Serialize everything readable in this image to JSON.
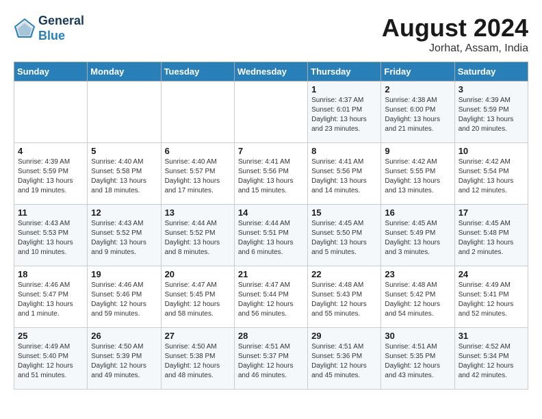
{
  "header": {
    "logo_line1": "General",
    "logo_line2": "Blue",
    "month_title": "August 2024",
    "location": "Jorhat, Assam, India"
  },
  "weekdays": [
    "Sunday",
    "Monday",
    "Tuesday",
    "Wednesday",
    "Thursday",
    "Friday",
    "Saturday"
  ],
  "weeks": [
    [
      {
        "day": "",
        "info": ""
      },
      {
        "day": "",
        "info": ""
      },
      {
        "day": "",
        "info": ""
      },
      {
        "day": "",
        "info": ""
      },
      {
        "day": "1",
        "info": "Sunrise: 4:37 AM\nSunset: 6:01 PM\nDaylight: 13 hours\nand 23 minutes."
      },
      {
        "day": "2",
        "info": "Sunrise: 4:38 AM\nSunset: 6:00 PM\nDaylight: 13 hours\nand 21 minutes."
      },
      {
        "day": "3",
        "info": "Sunrise: 4:39 AM\nSunset: 5:59 PM\nDaylight: 13 hours\nand 20 minutes."
      }
    ],
    [
      {
        "day": "4",
        "info": "Sunrise: 4:39 AM\nSunset: 5:59 PM\nDaylight: 13 hours\nand 19 minutes."
      },
      {
        "day": "5",
        "info": "Sunrise: 4:40 AM\nSunset: 5:58 PM\nDaylight: 13 hours\nand 18 minutes."
      },
      {
        "day": "6",
        "info": "Sunrise: 4:40 AM\nSunset: 5:57 PM\nDaylight: 13 hours\nand 17 minutes."
      },
      {
        "day": "7",
        "info": "Sunrise: 4:41 AM\nSunset: 5:56 PM\nDaylight: 13 hours\nand 15 minutes."
      },
      {
        "day": "8",
        "info": "Sunrise: 4:41 AM\nSunset: 5:56 PM\nDaylight: 13 hours\nand 14 minutes."
      },
      {
        "day": "9",
        "info": "Sunrise: 4:42 AM\nSunset: 5:55 PM\nDaylight: 13 hours\nand 13 minutes."
      },
      {
        "day": "10",
        "info": "Sunrise: 4:42 AM\nSunset: 5:54 PM\nDaylight: 13 hours\nand 12 minutes."
      }
    ],
    [
      {
        "day": "11",
        "info": "Sunrise: 4:43 AM\nSunset: 5:53 PM\nDaylight: 13 hours\nand 10 minutes."
      },
      {
        "day": "12",
        "info": "Sunrise: 4:43 AM\nSunset: 5:52 PM\nDaylight: 13 hours\nand 9 minutes."
      },
      {
        "day": "13",
        "info": "Sunrise: 4:44 AM\nSunset: 5:52 PM\nDaylight: 13 hours\nand 8 minutes."
      },
      {
        "day": "14",
        "info": "Sunrise: 4:44 AM\nSunset: 5:51 PM\nDaylight: 13 hours\nand 6 minutes."
      },
      {
        "day": "15",
        "info": "Sunrise: 4:45 AM\nSunset: 5:50 PM\nDaylight: 13 hours\nand 5 minutes."
      },
      {
        "day": "16",
        "info": "Sunrise: 4:45 AM\nSunset: 5:49 PM\nDaylight: 13 hours\nand 3 minutes."
      },
      {
        "day": "17",
        "info": "Sunrise: 4:45 AM\nSunset: 5:48 PM\nDaylight: 13 hours\nand 2 minutes."
      }
    ],
    [
      {
        "day": "18",
        "info": "Sunrise: 4:46 AM\nSunset: 5:47 PM\nDaylight: 13 hours\nand 1 minute."
      },
      {
        "day": "19",
        "info": "Sunrise: 4:46 AM\nSunset: 5:46 PM\nDaylight: 12 hours\nand 59 minutes."
      },
      {
        "day": "20",
        "info": "Sunrise: 4:47 AM\nSunset: 5:45 PM\nDaylight: 12 hours\nand 58 minutes."
      },
      {
        "day": "21",
        "info": "Sunrise: 4:47 AM\nSunset: 5:44 PM\nDaylight: 12 hours\nand 56 minutes."
      },
      {
        "day": "22",
        "info": "Sunrise: 4:48 AM\nSunset: 5:43 PM\nDaylight: 12 hours\nand 55 minutes."
      },
      {
        "day": "23",
        "info": "Sunrise: 4:48 AM\nSunset: 5:42 PM\nDaylight: 12 hours\nand 54 minutes."
      },
      {
        "day": "24",
        "info": "Sunrise: 4:49 AM\nSunset: 5:41 PM\nDaylight: 12 hours\nand 52 minutes."
      }
    ],
    [
      {
        "day": "25",
        "info": "Sunrise: 4:49 AM\nSunset: 5:40 PM\nDaylight: 12 hours\nand 51 minutes."
      },
      {
        "day": "26",
        "info": "Sunrise: 4:50 AM\nSunset: 5:39 PM\nDaylight: 12 hours\nand 49 minutes."
      },
      {
        "day": "27",
        "info": "Sunrise: 4:50 AM\nSunset: 5:38 PM\nDaylight: 12 hours\nand 48 minutes."
      },
      {
        "day": "28",
        "info": "Sunrise: 4:51 AM\nSunset: 5:37 PM\nDaylight: 12 hours\nand 46 minutes."
      },
      {
        "day": "29",
        "info": "Sunrise: 4:51 AM\nSunset: 5:36 PM\nDaylight: 12 hours\nand 45 minutes."
      },
      {
        "day": "30",
        "info": "Sunrise: 4:51 AM\nSunset: 5:35 PM\nDaylight: 12 hours\nand 43 minutes."
      },
      {
        "day": "31",
        "info": "Sunrise: 4:52 AM\nSunset: 5:34 PM\nDaylight: 12 hours\nand 42 minutes."
      }
    ]
  ]
}
